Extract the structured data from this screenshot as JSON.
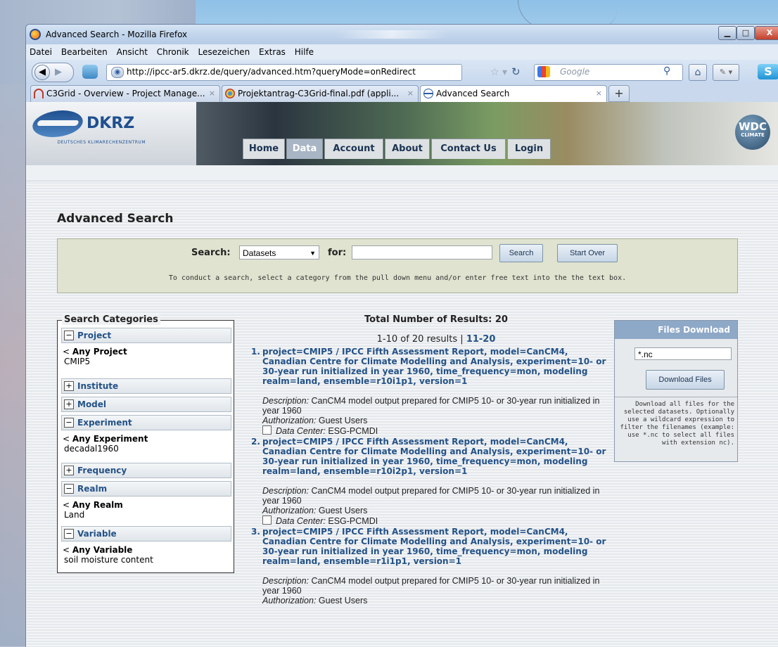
{
  "window": {
    "title": "Advanced Search - Mozilla Firefox",
    "buttons": {
      "minimize": "▁",
      "maximize": "□",
      "close": "X"
    }
  },
  "menu": [
    "Datei",
    "Bearbeiten",
    "Ansicht",
    "Chronik",
    "Lesezeichen",
    "Extras",
    "Hilfe"
  ],
  "navbar": {
    "url": "http://ipcc-ar5.dkrz.de/query/advanced.htm?queryMode=onRedirect",
    "search_placeholder": "Google"
  },
  "tabs": [
    {
      "label": "C3Grid - Overview - Project Manage...",
      "icon": "c3grid-icon",
      "active": false
    },
    {
      "label": "Projektantrag-C3Grid-final.pdf (appli...",
      "icon": "chrome-icon",
      "active": false
    },
    {
      "label": "Advanced Search",
      "icon": "site-icon",
      "active": true
    }
  ],
  "site": {
    "logo_text": "DKRZ",
    "logo_sub": "DEUTSCHES KLIMARECHENZENTRUM",
    "badge_title": "WDC",
    "badge_sub": "CLIMATE",
    "nav": [
      "Home",
      "Data",
      "Account",
      "About",
      "Contact Us",
      "Login"
    ],
    "nav_active": "Data"
  },
  "page_title": "Advanced Search",
  "search": {
    "label": "Search:",
    "category": "Datasets",
    "for_label": "for:",
    "query": "",
    "search_button": "Search",
    "start_over_button": "Start Over",
    "hint": "To conduct a search, select a category from the pull down menu and/or enter free text into the the text box."
  },
  "categories": {
    "legend": "Search Categories",
    "items": [
      {
        "name": "Project",
        "toggle": "−",
        "expanded": true,
        "any": "Any Project",
        "value": "CMIP5"
      },
      {
        "name": "Institute",
        "toggle": "+",
        "expanded": false
      },
      {
        "name": "Model",
        "toggle": "+",
        "expanded": false
      },
      {
        "name": "Experiment",
        "toggle": "−",
        "expanded": true,
        "any": "Any Experiment",
        "value": "decadal1960"
      },
      {
        "name": "Frequency",
        "toggle": "+",
        "expanded": false
      },
      {
        "name": "Realm",
        "toggle": "−",
        "expanded": true,
        "any": "Any Realm",
        "value": "Land"
      },
      {
        "name": "Variable",
        "toggle": "−",
        "expanded": true,
        "any": "Any Variable",
        "value": "soil moisture content"
      }
    ]
  },
  "results": {
    "total": "Total Number of Results: 20",
    "pager_current": "1-10 of 20 results",
    "pager_sep": "|",
    "pager_next": "11-20",
    "items": [
      {
        "num": "1.",
        "title": "project=CMIP5 / IPCC Fifth Assessment Report, model=CanCM4, Canadian Centre for Climate Modelling and Analysis, experiment=10- or 30-year run initialized in year 1960, time_frequency=mon, modeling realm=land, ensemble=r10i1p1, version=1",
        "desc_label": "Description:",
        "desc": "CanCM4 model output prepared for CMIP5 10- or 30-year run initialized in year 1960",
        "auth_label": "Authorization:",
        "auth": "Guest Users",
        "dc_label": "Data Center:",
        "dc": "ESG-PCMDI"
      },
      {
        "num": "2.",
        "title": "project=CMIP5 / IPCC Fifth Assessment Report, model=CanCM4, Canadian Centre for Climate Modelling and Analysis, experiment=10- or 30-year run initialized in year 1960, time_frequency=mon, modeling realm=land, ensemble=r10i2p1, version=1",
        "desc_label": "Description:",
        "desc": "CanCM4 model output prepared for CMIP5 10- or 30-year run initialized in year 1960",
        "auth_label": "Authorization:",
        "auth": "Guest Users",
        "dc_label": "Data Center:",
        "dc": "ESG-PCMDI"
      },
      {
        "num": "3.",
        "title": "project=CMIP5 / IPCC Fifth Assessment Report, model=CanCM4, Canadian Centre for Climate Modelling and Analysis, experiment=10- or 30-year run initialized in year 1960, time_frequency=mon, modeling realm=land, ensemble=r1i1p1, version=1",
        "desc_label": "Description:",
        "desc": "CanCM4 model output prepared for CMIP5 10- or 30-year run initialized in year 1960",
        "auth_label": "Authorization:",
        "auth": "Guest Users"
      }
    ]
  },
  "download": {
    "title": "Files Download",
    "pattern": "*.nc",
    "button": "Download Files",
    "hint": "Download all files for the selected datasets. Optionally use a wildcard expression to filter the filenames (example: use *.nc to select all files with extension nc)."
  }
}
